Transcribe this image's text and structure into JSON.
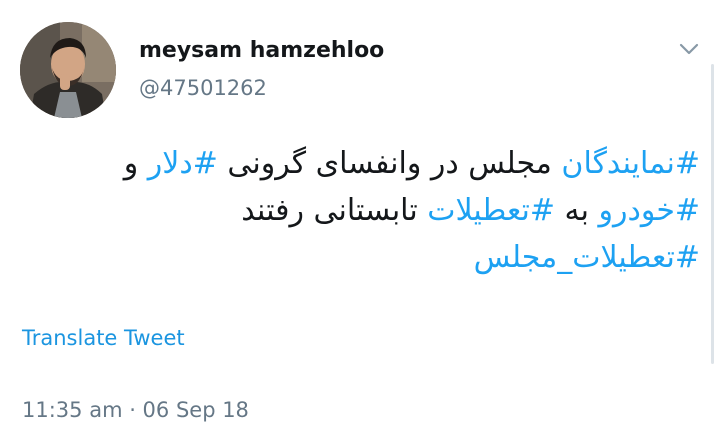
{
  "author": {
    "display_name": "meysam hamzehloo",
    "handle": "@47501262"
  },
  "tweet": {
    "lines": [
      [
        {
          "text": "#نمایندگان",
          "hashtag": true
        },
        {
          "text": " مجلس در وانفسای گرونی ",
          "hashtag": false
        },
        {
          "text": "#دلار",
          "hashtag": true
        },
        {
          "text": " و",
          "hashtag": false
        }
      ],
      [
        {
          "text": "#خودرو",
          "hashtag": true
        },
        {
          "text": " به ",
          "hashtag": false
        },
        {
          "text": "#تعطیلات",
          "hashtag": true
        },
        {
          "text": " تابستانی رفتند",
          "hashtag": false
        }
      ],
      [
        {
          "text": "#تعطیلات_مجلس",
          "hashtag": true
        }
      ]
    ]
  },
  "translate_label": "Translate Tweet",
  "timestamp": "11:35 am · 06 Sep 18",
  "colors": {
    "hashtag": "#1da1f2",
    "link": "#1b95e0",
    "secondary_text": "#657786",
    "primary_text": "#14171a"
  },
  "icons": {
    "menu": "chevron-down-icon",
    "avatar": "avatar-photo"
  }
}
